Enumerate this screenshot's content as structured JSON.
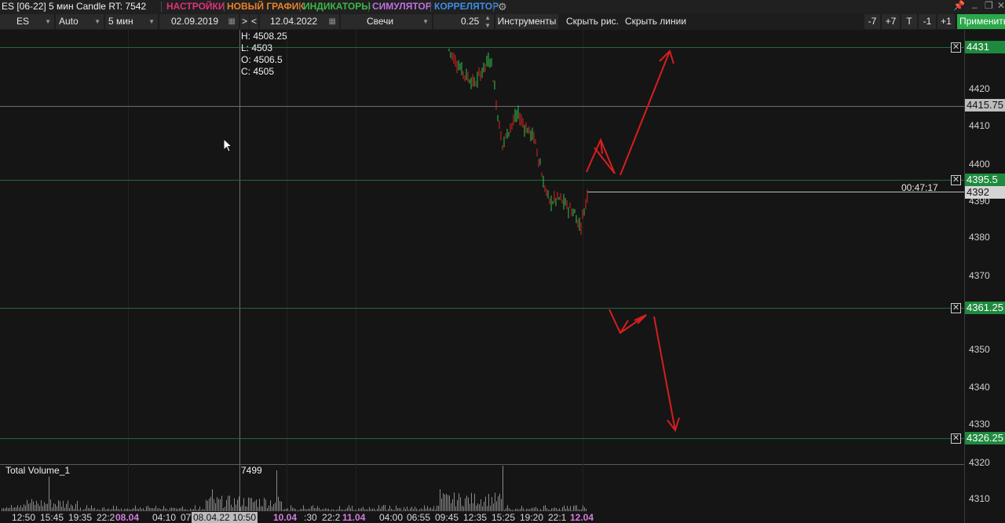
{
  "window": {
    "title": "ES [06-22] 5 мин Candle RT: 7542",
    "menu": [
      {
        "label": "НАСТРОЙКИ",
        "color": "#e0317a"
      },
      {
        "label": "НОВЫЙ ГРАФИК",
        "color": "#e8822a"
      },
      {
        "label": "ИНДИКАТОРЫ",
        "color": "#3cb84a"
      },
      {
        "label": "СИМУЛЯТОР",
        "color": "#c070e0"
      },
      {
        "label": "КОРРЕЛЯТОР",
        "color": "#3a8ee6"
      }
    ],
    "settings_icon": "gears-icon",
    "pin_icon": "pin-icon",
    "minimize_icon": "minimize-icon",
    "restore_icon": "restore-icon",
    "close_icon": "close-icon"
  },
  "toolbar": {
    "symbol": "ES",
    "scale": "Auto",
    "timeframe": "5 мин",
    "date_from": "02.09.2019",
    "nav_forward": ">",
    "nav_back": "<",
    "date_to": "12.04.2022",
    "chart_type": "Свечи",
    "tick_size": "0.25",
    "tools": "Инструменты",
    "hide_drawings": "Скрыть рис.",
    "hide_lines": "Скрыть линии",
    "buttons": [
      "-7",
      "+7",
      "T",
      "-1",
      "+1"
    ],
    "apply": "Применить"
  },
  "colors": {
    "up": "#2ec24a",
    "down": "#e02424",
    "level_line": "#1f6a3a",
    "level_badge": "#1e8a3e",
    "arrow": "#d81e1e",
    "crosshair": "#6e6e6e"
  },
  "chart": {
    "ohlc": {
      "h": "H: 4508.25",
      "l": "L: 4503",
      "o": "O: 4506.5",
      "c": "C: 4505"
    },
    "timer": "00:47:17",
    "price_ticks": [
      "4420",
      "4410",
      "4400",
      "4390",
      "4380",
      "4370",
      "4350",
      "4340",
      "4330",
      "4320",
      "4310"
    ],
    "levels": [
      {
        "price": "4431",
        "kind": "support"
      },
      {
        "price": "4395.5",
        "kind": "support"
      },
      {
        "price": "4361.25",
        "kind": "support"
      },
      {
        "price": "4326.25",
        "kind": "support"
      }
    ],
    "crosshair_price": "4415.75",
    "last_price": "4392",
    "volume": {
      "label": "Total Volume_1",
      "value": "7499"
    },
    "time_labels": [
      {
        "text": "12:50",
        "kind": "time"
      },
      {
        "text": "15:45",
        "kind": "time"
      },
      {
        "text": "19:35",
        "kind": "time"
      },
      {
        "text": "22:2",
        "kind": "time"
      },
      {
        "text": "08.04",
        "kind": "date"
      },
      {
        "text": "04:10",
        "kind": "time"
      },
      {
        "text": "07",
        "kind": "time"
      },
      {
        "text": "08.04.22 10:50",
        "kind": "cross"
      },
      {
        "text": "10.04",
        "kind": "date"
      },
      {
        "text": ":30",
        "kind": "time"
      },
      {
        "text": "22:2",
        "kind": "time"
      },
      {
        "text": "11.04",
        "kind": "date"
      },
      {
        "text": "04:00",
        "kind": "time"
      },
      {
        "text": "06:55",
        "kind": "time"
      },
      {
        "text": "09:45",
        "kind": "time"
      },
      {
        "text": "12:35",
        "kind": "time"
      },
      {
        "text": "15:25",
        "kind": "time"
      },
      {
        "text": "19:20",
        "kind": "time"
      },
      {
        "text": "22:1",
        "kind": "time"
      },
      {
        "text": "12.04",
        "kind": "date"
      }
    ]
  }
}
